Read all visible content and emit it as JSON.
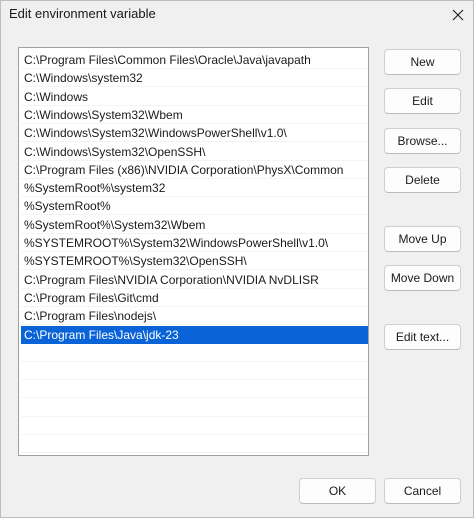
{
  "window": {
    "title": "Edit environment variable",
    "close_icon": "close-icon"
  },
  "paths": [
    "C:\\Program Files\\Common Files\\Oracle\\Java\\javapath",
    "C:\\Windows\\system32",
    "C:\\Windows",
    "C:\\Windows\\System32\\Wbem",
    "C:\\Windows\\System32\\WindowsPowerShell\\v1.0\\",
    "C:\\Windows\\System32\\OpenSSH\\",
    "C:\\Program Files (x86)\\NVIDIA Corporation\\PhysX\\Common",
    "%SystemRoot%\\system32",
    "%SystemRoot%",
    "%SystemRoot%\\System32\\Wbem",
    "%SYSTEMROOT%\\System32\\WindowsPowerShell\\v1.0\\",
    "%SYSTEMROOT%\\System32\\OpenSSH\\",
    "C:\\Program Files\\NVIDIA Corporation\\NVIDIA NvDLISR",
    "C:\\Program Files\\Git\\cmd",
    "C:\\Program Files\\nodejs\\",
    "C:\\Program Files\\Java\\jdk-23"
  ],
  "selected_index": 15,
  "empty_rows": 6,
  "buttons": {
    "new": "New",
    "edit": "Edit",
    "browse": "Browse...",
    "delete": "Delete",
    "move_up": "Move Up",
    "move_down": "Move Down",
    "edit_text": "Edit text...",
    "ok": "OK",
    "cancel": "Cancel"
  },
  "colors": {
    "selection": "#0a64d8",
    "dialog_bg": "#f0f0f0"
  }
}
